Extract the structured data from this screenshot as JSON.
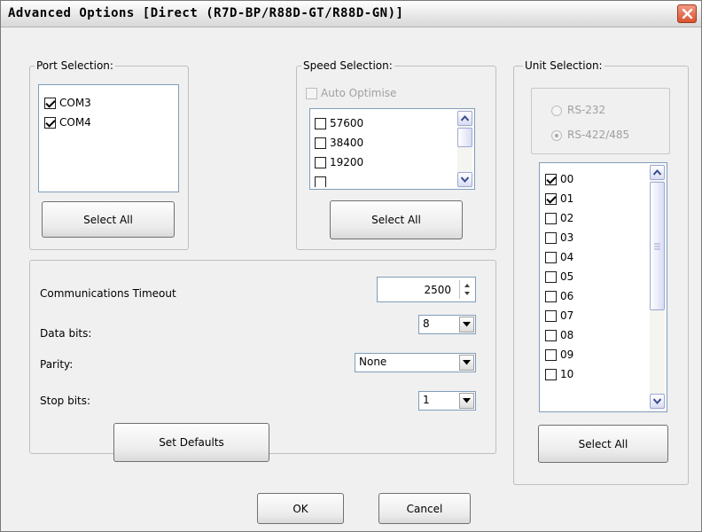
{
  "window": {
    "title": "Advanced Options [Direct (R7D-BP/R88D-GT/R88D-GN)]"
  },
  "port_selection": {
    "legend": "Port Selection:",
    "items": [
      {
        "label": "COM3",
        "checked": true
      },
      {
        "label": "COM4",
        "checked": true
      }
    ],
    "select_all_label": "Select All"
  },
  "speed_selection": {
    "legend": "Speed Selection:",
    "auto_optimise_label": "Auto Optimise",
    "auto_optimise_checked": false,
    "items": [
      {
        "label": "57600",
        "checked": false
      },
      {
        "label": "38400",
        "checked": false
      },
      {
        "label": "19200",
        "checked": false
      }
    ],
    "select_all_label": "Select All"
  },
  "settings": {
    "comm_timeout_label": "Communications Timeout",
    "comm_timeout_value": "2500",
    "data_bits_label": "Data bits:",
    "data_bits_value": "8",
    "parity_label": "Parity:",
    "parity_value": "None",
    "stop_bits_label": "Stop bits:",
    "stop_bits_value": "1",
    "set_defaults_label": "Set Defaults"
  },
  "unit_selection": {
    "legend": "Unit Selection:",
    "rs232_label": "RS-232",
    "rs422_label": "RS-422/485",
    "selected_interface": "RS-422/485",
    "units": [
      {
        "label": "00",
        "checked": true
      },
      {
        "label": "01",
        "checked": true
      },
      {
        "label": "02",
        "checked": false
      },
      {
        "label": "03",
        "checked": false
      },
      {
        "label": "04",
        "checked": false
      },
      {
        "label": "05",
        "checked": false
      },
      {
        "label": "06",
        "checked": false
      },
      {
        "label": "07",
        "checked": false
      },
      {
        "label": "08",
        "checked": false
      },
      {
        "label": "09",
        "checked": false
      },
      {
        "label": "10",
        "checked": false
      }
    ],
    "select_all_label": "Select All"
  },
  "footer": {
    "ok_label": "OK",
    "cancel_label": "Cancel"
  },
  "icons": {
    "close": "close-icon",
    "scroll_up": "arrow-up-icon",
    "scroll_down": "arrow-down-icon",
    "dropdown": "chevron-down-icon",
    "spinner": "spin-arrows-icon"
  },
  "colors": {
    "close_button": "#D9532F",
    "dialog_background": "#F0F0F0",
    "border_blue": "#7F9DB9"
  }
}
